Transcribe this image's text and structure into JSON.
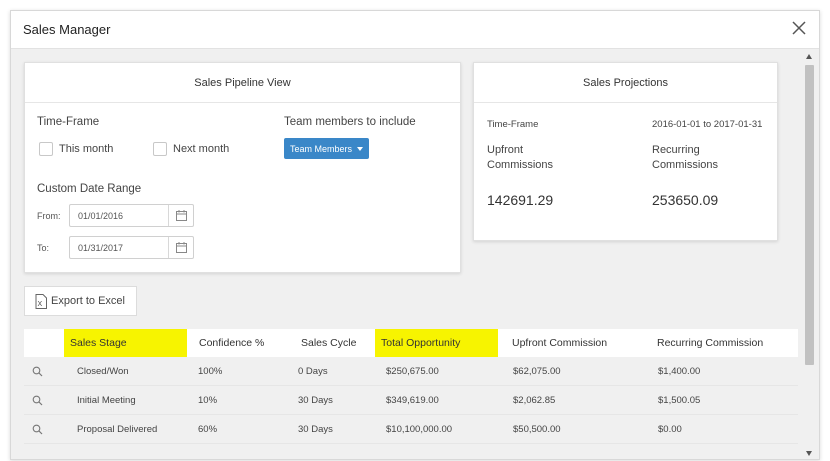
{
  "window": {
    "title": "Sales Manager"
  },
  "pipeline": {
    "title": "Sales Pipeline View",
    "timeframe_label": "Time-Frame",
    "this_month_label": "This month",
    "next_month_label": "Next month",
    "team_label": "Team members to include",
    "team_button_label": "Team Members",
    "custom_range_label": "Custom Date Range",
    "from_label": "From:",
    "from_value": "01/01/2016",
    "to_label": "To:",
    "to_value": "01/31/2017"
  },
  "projections": {
    "title": "Sales Projections",
    "timeframe_label": "Time-Frame",
    "timeframe_value": "2016-01-01 to 2017-01-31",
    "upfront_label": "Upfront Commissions",
    "recurring_label": "Recurring Commissions",
    "upfront_value": "142691.29",
    "recurring_value": "253650.09"
  },
  "toolbar": {
    "export_label": "Export to Excel"
  },
  "table": {
    "columns": [
      "Sales Stage",
      "Confidence %",
      "Sales Cycle",
      "Total Opportunity",
      "Upfront Commission",
      "Recurring Commission"
    ],
    "rows": [
      [
        "Closed/Won",
        "100%",
        "0 Days",
        "$250,675.00",
        "$62,075.00",
        "$1,400.00"
      ],
      [
        "Initial Meeting",
        "10%",
        "30 Days",
        "$349,619.00",
        "$2,062.85",
        "$1,500.05"
      ],
      [
        "Proposal Delivered",
        "60%",
        "30 Days",
        "$10,100,000.00",
        "$50,500.00",
        "$0.00"
      ]
    ]
  },
  "colors": {
    "accent": "#3a87c8",
    "highlight": "#f7f400"
  }
}
